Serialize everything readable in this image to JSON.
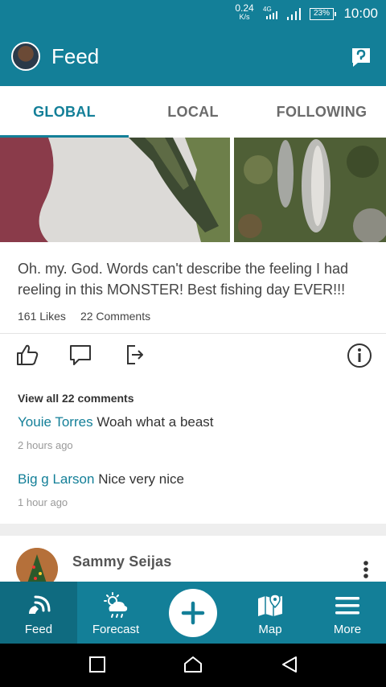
{
  "status_bar": {
    "speed_value": "0.24",
    "speed_unit": "K/s",
    "network_type": "4G",
    "battery": "23%",
    "time": "10:00"
  },
  "app_bar": {
    "title": "Feed"
  },
  "tabs": [
    {
      "label": "GLOBAL",
      "active": true
    },
    {
      "label": "LOCAL",
      "active": false
    },
    {
      "label": "FOLLOWING",
      "active": false
    }
  ],
  "post": {
    "text": "Oh. my. God. Words can't describe the feeling I had reeling in this MONSTER! Best fishing day EVER!!!",
    "likes": "161 Likes",
    "comments_count": "22 Comments",
    "view_all": "View all 22 comments",
    "comments": [
      {
        "author": "Youie Torres",
        "text": "Woah what a beast",
        "time": "2 hours ago"
      },
      {
        "author": "Big g Larson",
        "text": "Nice very nice",
        "time": "1 hour ago"
      }
    ]
  },
  "next_post": {
    "author": "Sammy Seijas"
  },
  "bottom_nav": {
    "feed": "Feed",
    "forecast": "Forecast",
    "map": "Map",
    "more": "More"
  },
  "colors": {
    "primary": "#137f98",
    "primary_dark": "#0f6b80",
    "text": "#444444"
  }
}
